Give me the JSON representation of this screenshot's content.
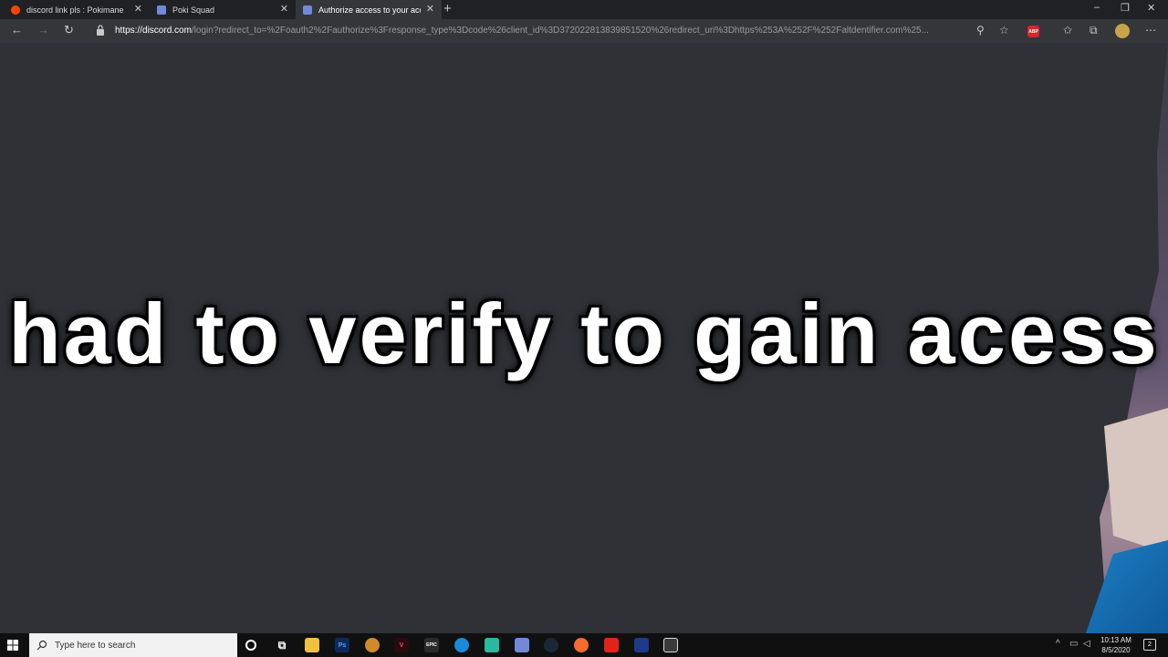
{
  "browser": {
    "tabs": [
      {
        "label": "discord link pls : Pokimane",
        "favicon_color": "#ff4500"
      },
      {
        "label": "Poki Squad",
        "favicon_color": "#7289da"
      },
      {
        "label": "Authorize access to your account",
        "favicon_color": "#7289da"
      }
    ],
    "window_controls": {
      "minimize": "–",
      "restore": "❐",
      "close": "✕"
    },
    "address": {
      "host": "https://discord.com",
      "path": "/login?redirect_to=%2Foauth2%2Fauthorize%3Fresponse_type%3Dcode%26client_id%3D372022813839851520%26redirect_uri%3Dhttps%253A%252F%252Faltdentifier.com%25..."
    },
    "extension_label": "ABP"
  },
  "page": {
    "caption": "had to verify to gain acess"
  },
  "taskbar": {
    "search_placeholder": "Type here to search",
    "apps": [
      "cortana-icon",
      "task-view-icon",
      "file-explorer-icon",
      "photoshop-icon",
      "app-icon",
      "valorant-icon",
      "epic-games-icon",
      "edge-icon",
      "app-icon",
      "discord-icon",
      "steam-icon",
      "origin-icon",
      "roblox-icon",
      "app-icon",
      "app-icon"
    ],
    "photoshop_label": "Ps",
    "epic_label": "EPIC",
    "time": "10:13 AM",
    "date": "8/5/2020",
    "notifications": "2"
  },
  "colors": {
    "page_background": "#2f3136",
    "browser_chrome": "#35363a",
    "taskbar": "#101010"
  }
}
